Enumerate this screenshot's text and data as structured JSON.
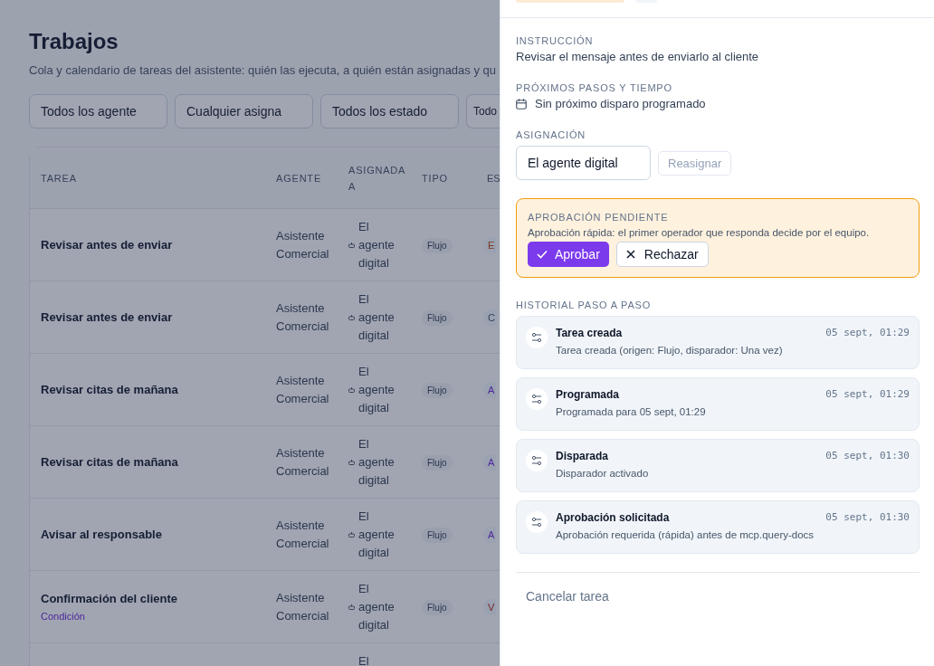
{
  "page": {
    "title": "Trabajos",
    "subtitle": "Cola y calendario de tareas del asistente: quién las ejecuta, a quién están asignadas y qu"
  },
  "filters": [
    "Todos los agente",
    "Cualquier asigna",
    "Todos los estado",
    "Todo"
  ],
  "table": {
    "columns": [
      "TAREA",
      "AGENTE",
      "ASIGNADA A",
      "TIPO",
      "ES"
    ],
    "rows": [
      {
        "task": "Revisar antes de enviar",
        "agent": "Asistente Comercial",
        "assigned": "El agente digital",
        "type": "Flujo",
        "status": "E",
        "color": "#7d3724"
      },
      {
        "task": "Revisar antes de enviar",
        "agent": "Asistente Comercial",
        "assigned": "El agente digital",
        "type": "Flujo",
        "status": "C",
        "color": "#364258"
      },
      {
        "task": "Revisar citas de mañana",
        "agent": "Asistente Comercial",
        "assigned": "El agente digital",
        "type": "Flujo",
        "status": "A",
        "color": "#4c289b"
      },
      {
        "task": "Revisar citas de mañana",
        "agent": "Asistente Comercial",
        "assigned": "El agente digital",
        "type": "Flujo",
        "status": "A",
        "color": "#4c289b"
      },
      {
        "task": "Avisar al responsable",
        "agent": "Asistente Comercial",
        "assigned": "El agente digital",
        "type": "Flujo",
        "status": "A",
        "color": "#4c289b"
      },
      {
        "task": "Confirmación del cliente",
        "note": "Condición",
        "agent": "Asistente Comercial",
        "assigned": "El agente digital",
        "type": "Flujo",
        "status": "V",
        "color": "#782127"
      },
      {
        "assigned": "El"
      }
    ]
  },
  "drawer": {
    "instruction": {
      "label": "INSTRUCCIÓN",
      "text": "Revisar el mensaje antes de enviarlo al cliente"
    },
    "next": {
      "label": "PRÓXIMOS PASOS Y TIEMPO",
      "text": "Sin próximo disparo programado"
    },
    "assignment": {
      "label": "ASIGNACIÓN",
      "value": "El agente digital",
      "button": "Reasignar",
      "disabled": true
    },
    "approval": {
      "label": "APROBACIÓN PENDIENTE",
      "text": "Aprobación rápida: el primer operador que responda decide por el equipo.",
      "approve": "Aprobar",
      "reject": "Rechazar"
    },
    "history": {
      "label": "HISTORIAL PASO A PASO",
      "items": [
        {
          "title": "Tarea creada",
          "time": "05 sept, 01:29",
          "detail": "Tarea creada (origen: Flujo, disparador: Una vez)"
        },
        {
          "title": "Programada",
          "time": "05 sept, 01:29",
          "detail": "Programada para 05 sept, 01:29"
        },
        {
          "title": "Disparada",
          "time": "05 sept, 01:30",
          "detail": "Disparador activado"
        },
        {
          "title": "Aprobación solicitada",
          "time": "05 sept, 01:30",
          "detail": "Aprobación requerida (rápida) antes de mcp.query-docs"
        }
      ]
    },
    "cancel": "Cancelar tarea"
  }
}
